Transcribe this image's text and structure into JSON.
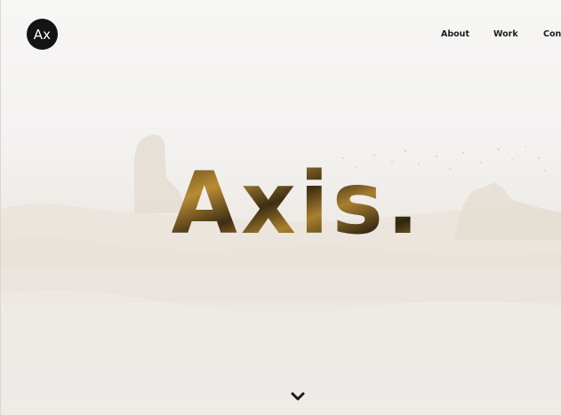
{
  "header": {
    "logo_text": "Ax",
    "nav": [
      {
        "label": "About"
      },
      {
        "label": "Work"
      },
      {
        "label": "Conta"
      }
    ]
  },
  "hero": {
    "title": "Axis.",
    "scroll_icon": "chevron-down-icon"
  },
  "colors": {
    "background": "#f3f1ef",
    "logo_bg": "#141414",
    "nav_text": "#1d1d1d",
    "title_fill_dark": "#3e2e14",
    "title_fill_gold": "#b98c33"
  }
}
